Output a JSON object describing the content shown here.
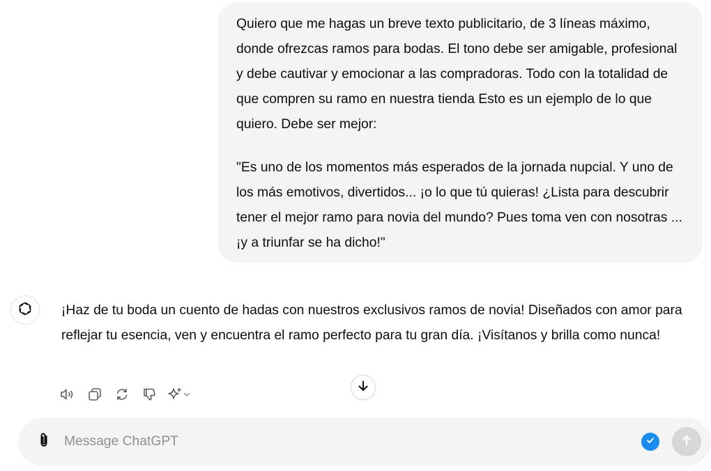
{
  "conversation": {
    "user_message": {
      "paragraph_1": "Quiero que me hagas un breve texto publicitario, de 3 líneas máximo, donde ofrezcas ramos para bodas. El tono debe ser amigable, profesional y debe cautivar y emocionar a las compradoras. Todo con la totalidad de que compren su ramo en nuestra tienda Esto es un ejemplo de lo que quiero. Debe ser mejor:",
      "paragraph_2": "\"Es uno de los momentos más esperados de la jornada nupcial. Y uno de los más emotivos, divertidos... ¡o lo que tú quieras! ¿Lista para descubrir tener el mejor ramo para novia del mundo? Pues toma ven con nosotras ... ¡y a triunfar se ha dicho!\""
    },
    "assistant_message": {
      "text": "¡Haz de tu boda un cuento de hadas con nuestros exclusivos ramos de novia! Diseñados con amor para reflejar tu esencia, ven y encuentra el ramo perfecto para tu gran día. ¡Visítanos y brilla como nunca!",
      "avatar_icon": "openai-logo-icon"
    },
    "message_actions": [
      "read-aloud-icon",
      "copy-icon",
      "regenerate-icon",
      "thumbs-down-icon",
      "sparkle-model-icon",
      "chevron-down-icon"
    ]
  },
  "scroll_button": {
    "icon": "arrow-down-icon"
  },
  "composer": {
    "placeholder": "Message ChatGPT",
    "value": "",
    "attach_icon": "paperclip-icon",
    "status_icon": "check-circle-icon",
    "send_icon": "arrow-up-icon"
  },
  "colors": {
    "user_bubble_bg": "#f4f4f4",
    "composer_bg": "#f4f4f4",
    "check_accent": "#1a8cf0",
    "send_disabled": "#d7d7d7"
  }
}
